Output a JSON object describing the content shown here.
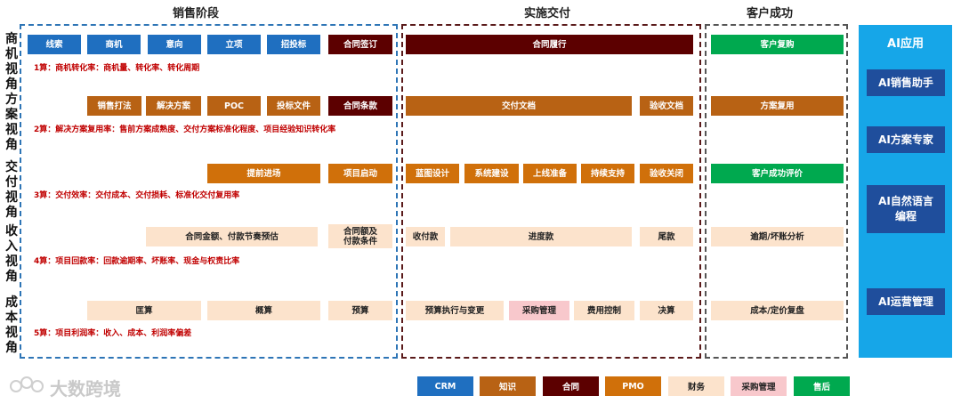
{
  "colors": {
    "crm": "#1F6FC0",
    "knowledge": "#B86214",
    "contract": "#5C0000",
    "pmo": "#D0700A",
    "finance": "#FCE3CC",
    "procurement": "#F8C8CC",
    "aftersales": "#00A94F",
    "ai_panel": "#16A6E8",
    "ai_button": "#1F4E9C"
  },
  "stages": {
    "sales": "销售阶段",
    "delivery": "实施交付",
    "success": "客户成功"
  },
  "rows": {
    "opportunity": {
      "label": "商机视角",
      "note": "1算：商机转化率：商机量、转化率、转化周期",
      "boxes": [
        "线索",
        "商机",
        "意向",
        "立项",
        "招投标",
        "合同签订",
        "合同履行",
        "客户复购"
      ]
    },
    "solution": {
      "label": "方案视角",
      "note": "2算：解决方案复用率：售前方案成熟度、交付方案标准化程度、项目经验知识转化率",
      "boxes": [
        "销售打法",
        "解决方案",
        "POC",
        "投标文件",
        "合同条款",
        "交付文档",
        "验收文档",
        "方案复用"
      ]
    },
    "delivery": {
      "label": "交付视角",
      "note": "3算：交付效率：交付成本、交付损耗、标准化交付复用率",
      "boxes": [
        "提前进场",
        "项目启动",
        "蓝图设计",
        "系统建设",
        "上线准备",
        "持续支持",
        "验收关闭",
        "客户成功评价"
      ]
    },
    "income": {
      "label": "收入视角",
      "note": "4算：项目回款率：回款逾期率、坏账率、现金与权责比率",
      "boxes": [
        "合同金额、付款节奏预估",
        "合同额及\n付款条件",
        "收付款",
        "进度款",
        "尾款",
        "逾期/坏账分析"
      ]
    },
    "cost": {
      "label": "成本视角",
      "note": "5算：项目利润率：收入、成本、利润率偏差",
      "boxes": [
        "匡算",
        "概算",
        "预算",
        "预算执行与变更",
        "采购管理",
        "费用控制",
        "决算",
        "成本/定价复盘"
      ]
    }
  },
  "ai": {
    "title": "AI应用",
    "items": [
      "AI销售助手",
      "AI方案专家",
      "AI自然语言\n编程",
      "AI运营管理"
    ]
  },
  "legend": [
    "CRM",
    "知识",
    "合同",
    "PMO",
    "财务",
    "采购管理",
    "售后"
  ],
  "watermark": "大数跨境"
}
